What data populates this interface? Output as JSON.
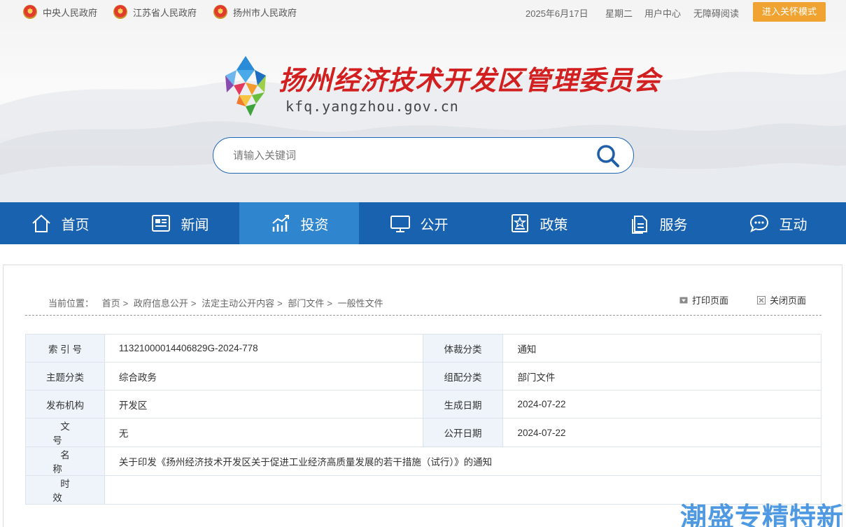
{
  "topbar": {
    "gov_links": [
      "中央人民政府",
      "江苏省人民政府",
      "扬州市人民政府"
    ],
    "date": "2025年6月17日",
    "weekday": "星期二",
    "user_center": "用户中心",
    "accessibility": "无障碍阅读",
    "care_mode": "进入关怀模式"
  },
  "logo": {
    "name_cn": "扬州经济技术开发区管理委员会",
    "domain": "kfq.yangzhou.gov.cn"
  },
  "search": {
    "placeholder": "请输入关键词"
  },
  "nav": {
    "items": [
      "首页",
      "新闻",
      "投资",
      "公开",
      "政策",
      "服务",
      "互动"
    ],
    "active": "投资"
  },
  "breadcrumb": {
    "label": "当前位置：",
    "items": [
      "首页",
      "政府信息公开",
      "法定主动公开内容",
      "部门文件",
      "一般性文件"
    ]
  },
  "tools": {
    "print": "打印页面",
    "close": "关闭页面"
  },
  "meta": {
    "index_no_label": "索 引 号",
    "index_no": "11321000014406829G-2024-778",
    "genre_label": "体裁分类",
    "genre": "通知",
    "topic_label": "主题分类",
    "topic": "综合政务",
    "org_class_label": "组配分类",
    "org_class": "部门文件",
    "publisher_label": "发布机构",
    "publisher": "开发区",
    "created_label": "生成日期",
    "created": "2024-07-22",
    "doc_no_label": "文 号",
    "doc_no": "无",
    "published_label": "公开日期",
    "published": "2024-07-22",
    "title_label": "名 称",
    "title": "关于印发《扬州经济技术开发区关于促进工业经济高质量发展的若干措施（试行）》的通知",
    "validity_label": "时 效",
    "validity": ""
  },
  "watermark": "潮盛专精特新"
}
